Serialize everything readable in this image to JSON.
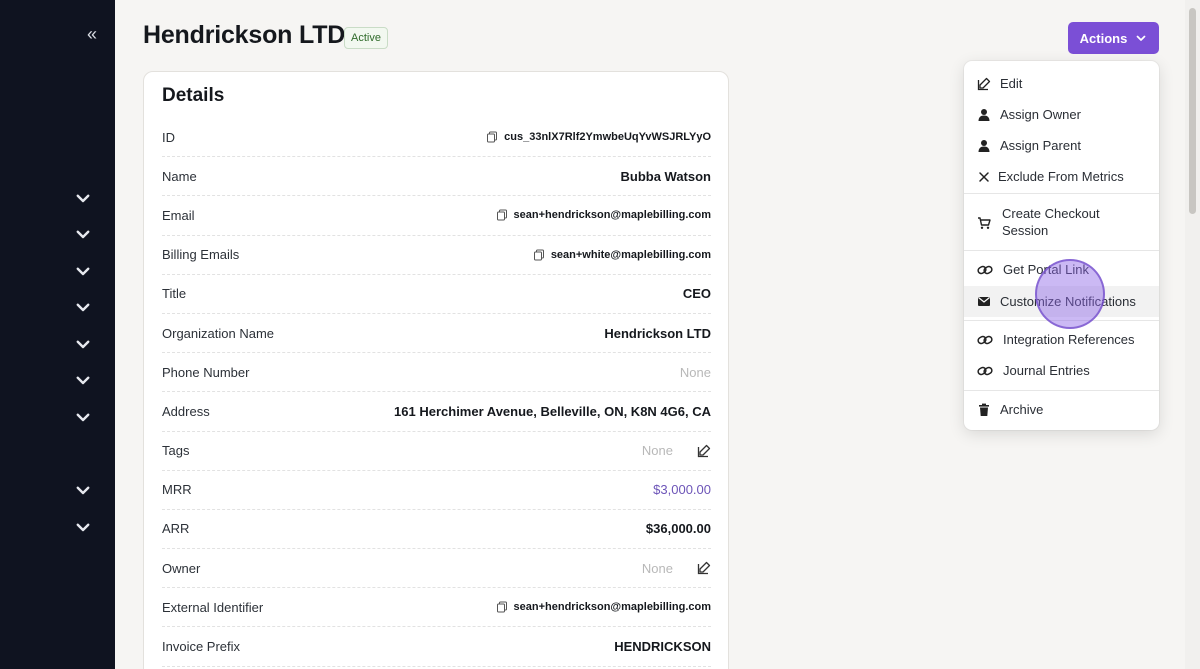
{
  "sidebar": {
    "collapse_icon": "double-chevron-left-icon",
    "chevron_icon": "chevron-down-icon"
  },
  "header": {
    "title": "Hendrickson LTD",
    "status": "Active",
    "actions_label": "Actions"
  },
  "details": {
    "title": "Details",
    "rows": [
      {
        "label": "ID",
        "value": "cus_33nlX7Rlf2YmwbeUqYvWSJRLYyO"
      },
      {
        "label": "Name",
        "value": "Bubba Watson"
      },
      {
        "label": "Email",
        "value": "sean+hendrickson@maplebilling.com"
      },
      {
        "label": "Billing Emails",
        "value": "sean+white@maplebilling.com"
      },
      {
        "label": "Title",
        "value": "CEO"
      },
      {
        "label": "Organization Name",
        "value": "Hendrickson LTD"
      },
      {
        "label": "Phone Number",
        "value": "None"
      },
      {
        "label": "Address",
        "value": "161 Herchimer Avenue, Belleville, ON, K8N 4G6, CA"
      },
      {
        "label": "Tags",
        "value": "None"
      },
      {
        "label": "MRR",
        "value": "$3,000.00"
      },
      {
        "label": "ARR",
        "value": "$36,000.00"
      },
      {
        "label": "Owner",
        "value": "None"
      },
      {
        "label": "External Identifier",
        "value": "sean+hendrickson@maplebilling.com"
      },
      {
        "label": "Invoice Prefix",
        "value": "HENDRICKSON"
      }
    ]
  },
  "menu": {
    "items": [
      {
        "label": "Edit",
        "icon": "edit-icon"
      },
      {
        "label": "Assign Owner",
        "icon": "user-icon"
      },
      {
        "label": "Assign Parent",
        "icon": "user-icon"
      },
      {
        "label": "Exclude From Metrics",
        "icon": "x-icon"
      },
      {
        "label": "Create Checkout Session",
        "icon": "cart-icon"
      },
      {
        "label": "Get Portal Link",
        "icon": "link-icon"
      },
      {
        "label": "Customize Notifications",
        "icon": "envelope-icon"
      },
      {
        "label": "Integration References",
        "icon": "link-icon"
      },
      {
        "label": "Journal Entries",
        "icon": "link-icon"
      },
      {
        "label": "Archive",
        "icon": "trash-icon"
      }
    ]
  },
  "colors": {
    "accent": "#7b4fd6",
    "sidebar_bg": "#0f1320",
    "status_green": "#2f6b2a",
    "link": "#6d55b8"
  }
}
